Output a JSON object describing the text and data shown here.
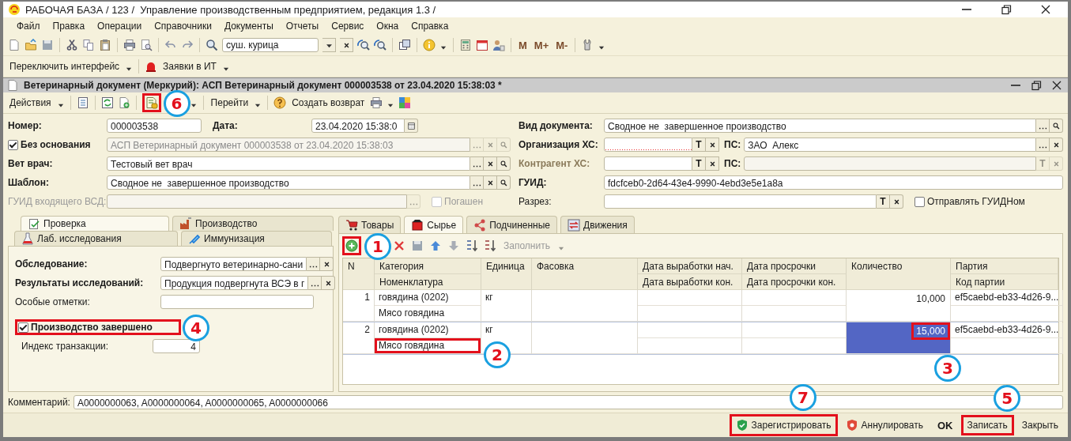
{
  "window": {
    "title": "РАБОЧАЯ БАЗА / 123 /  Управление производственным предприятием, редакция 1.3 /"
  },
  "menu": [
    {
      "label": "Файл"
    },
    {
      "label": "Правка"
    },
    {
      "label": "Операции"
    },
    {
      "label": "Справочники"
    },
    {
      "label": "Документы"
    },
    {
      "label": "Отчеты"
    },
    {
      "label": "Сервис"
    },
    {
      "label": "Окна"
    },
    {
      "label": "Справка"
    }
  ],
  "toolbar": {
    "search": {
      "value": "суш. курица"
    },
    "memory": [
      "M",
      "M+",
      "M-"
    ]
  },
  "panel_bar": [
    {
      "label": "Переключить интерфейс"
    },
    {
      "label": "Заявки в ИТ"
    }
  ],
  "document": {
    "title": "Ветеринарный документ (Меркурий): АСП Ветеринарный документ 000003538 от 23.04.2020 15:38:03 *",
    "toolbar": {
      "actions": "Действия",
      "goto": "Перейти",
      "create_return": "Создать возврат",
      "fill_button": {
        "highlighted": true,
        "callout": "6"
      }
    }
  },
  "header": {
    "number": {
      "label": "Номер:",
      "value": "000003538"
    },
    "date": {
      "label": "Дата:",
      "value": "23.04.2020 15:38:0"
    },
    "no_basis": {
      "label": "Без основания",
      "checked": true,
      "value": "АСП Ветеринарный документ 000003538 от 23.04.2020 15:38:03",
      "disabled": true
    },
    "vet": {
      "label": "Вет врач:",
      "value": "Тестовый вет врач"
    },
    "template": {
      "label": "Шаблон:",
      "value": "Сводное не  завершенное производство"
    },
    "incoming_guid": {
      "label": "ГУИД входящего ВСД:",
      "disabled": true
    },
    "redeemed": {
      "label": "Погашен",
      "checked": false,
      "disabled": true
    },
    "doc_kind": {
      "label": "Вид документа:",
      "value": "Сводное не  завершенное производство"
    },
    "org": {
      "label": "Организация ХС:",
      "required": true,
      "type_button": "T",
      "ps_label": "ПС:",
      "ps_value": "ЗАО  Алекс"
    },
    "counterparty": {
      "label": "Контрагент ХС:",
      "disabled": true,
      "type_button": "T",
      "ps_label": "ПС:",
      "ps_type_button": "T"
    },
    "guid": {
      "label": "ГУИД:",
      "value": "fdcfceb0-2d64-43e4-9990-4ebd3e5e1a8a"
    },
    "section": {
      "label": "Разрез:",
      "type_button": "T"
    },
    "send_guid": {
      "label": "Отправлять ГУИДНом",
      "checked": false
    }
  },
  "check_panel": {
    "tabs": [
      {
        "label": "Проверка",
        "selected": true
      },
      {
        "label": "Производство",
        "selected": false
      },
      {
        "label": "Лаб. исследования",
        "selected": false
      },
      {
        "label": "Иммунизация",
        "selected": false
      }
    ],
    "inspection": {
      "label": "Обследование:",
      "value": "Подвергнуто ветеринарно-сани"
    },
    "results": {
      "label": "Результаты исследований:",
      "value": "Продукция подвергнута ВСЭ в г"
    },
    "notes": {
      "label": "Особые отметки:"
    },
    "production_done": {
      "label": "Производство завершено",
      "checked": true,
      "highlighted": true,
      "callout": "4"
    },
    "tx_index": {
      "label": "Индекс транзакции:",
      "value": "4"
    }
  },
  "goods_panel": {
    "tabs": [
      {
        "label": "Товары",
        "selected": false
      },
      {
        "label": "Сырье",
        "selected": true
      },
      {
        "label": "Подчиненные",
        "selected": false
      },
      {
        "label": "Движения",
        "selected": false
      }
    ],
    "add_button": {
      "highlighted": true,
      "callout": "1"
    },
    "fill": {
      "label": "Заполнить",
      "disabled": true
    },
    "columns": [
      {
        "top": "N"
      },
      {
        "top": "Категория",
        "bottom": "Номенклатура"
      },
      {
        "top": "Единица"
      },
      {
        "top": "Фасовка"
      },
      {
        "top": "Дата выработки нач.",
        "bottom": "Дата выработки кон."
      },
      {
        "top": "Дата просрочки",
        "bottom": "Дата просрочки кон."
      },
      {
        "top": "Количество"
      },
      {
        "top": "Партия",
        "bottom": "Код партии"
      }
    ],
    "rows": [
      {
        "n": "1",
        "category": "говядина (0202)",
        "nomenclature": {
          "text": "Мясо говядина",
          "highlighted": false
        },
        "unit": "кг",
        "quantity": {
          "text": "10,000",
          "selected": false,
          "highlighted": false
        },
        "batch": "ef5caebd-eb33-4d26-9..."
      },
      {
        "n": "2",
        "category": "говядина (0202)",
        "nomenclature": {
          "text": "Мясо говядина",
          "highlighted": true,
          "callout": "2"
        },
        "unit": "кг",
        "quantity": {
          "text": "15,000",
          "selected": true,
          "highlighted": true,
          "callout": "3"
        },
        "batch": "ef5caebd-eb33-4d26-9..."
      }
    ]
  },
  "comment": {
    "label": "Комментарий:",
    "value": "A0000000063, A0000000064, A0000000065, A0000000066"
  },
  "footer": [
    {
      "label": "Зарегистрировать",
      "kind": "register",
      "highlighted": true,
      "callout": "7"
    },
    {
      "label": "Аннулировать",
      "kind": "cancel",
      "highlighted": false
    },
    {
      "label": "OK",
      "kind": "ok",
      "highlighted": false
    },
    {
      "label": "Записать",
      "kind": "save",
      "highlighted": true,
      "callout": "5"
    },
    {
      "label": "Закрыть",
      "kind": "close",
      "highlighted": false
    }
  ]
}
